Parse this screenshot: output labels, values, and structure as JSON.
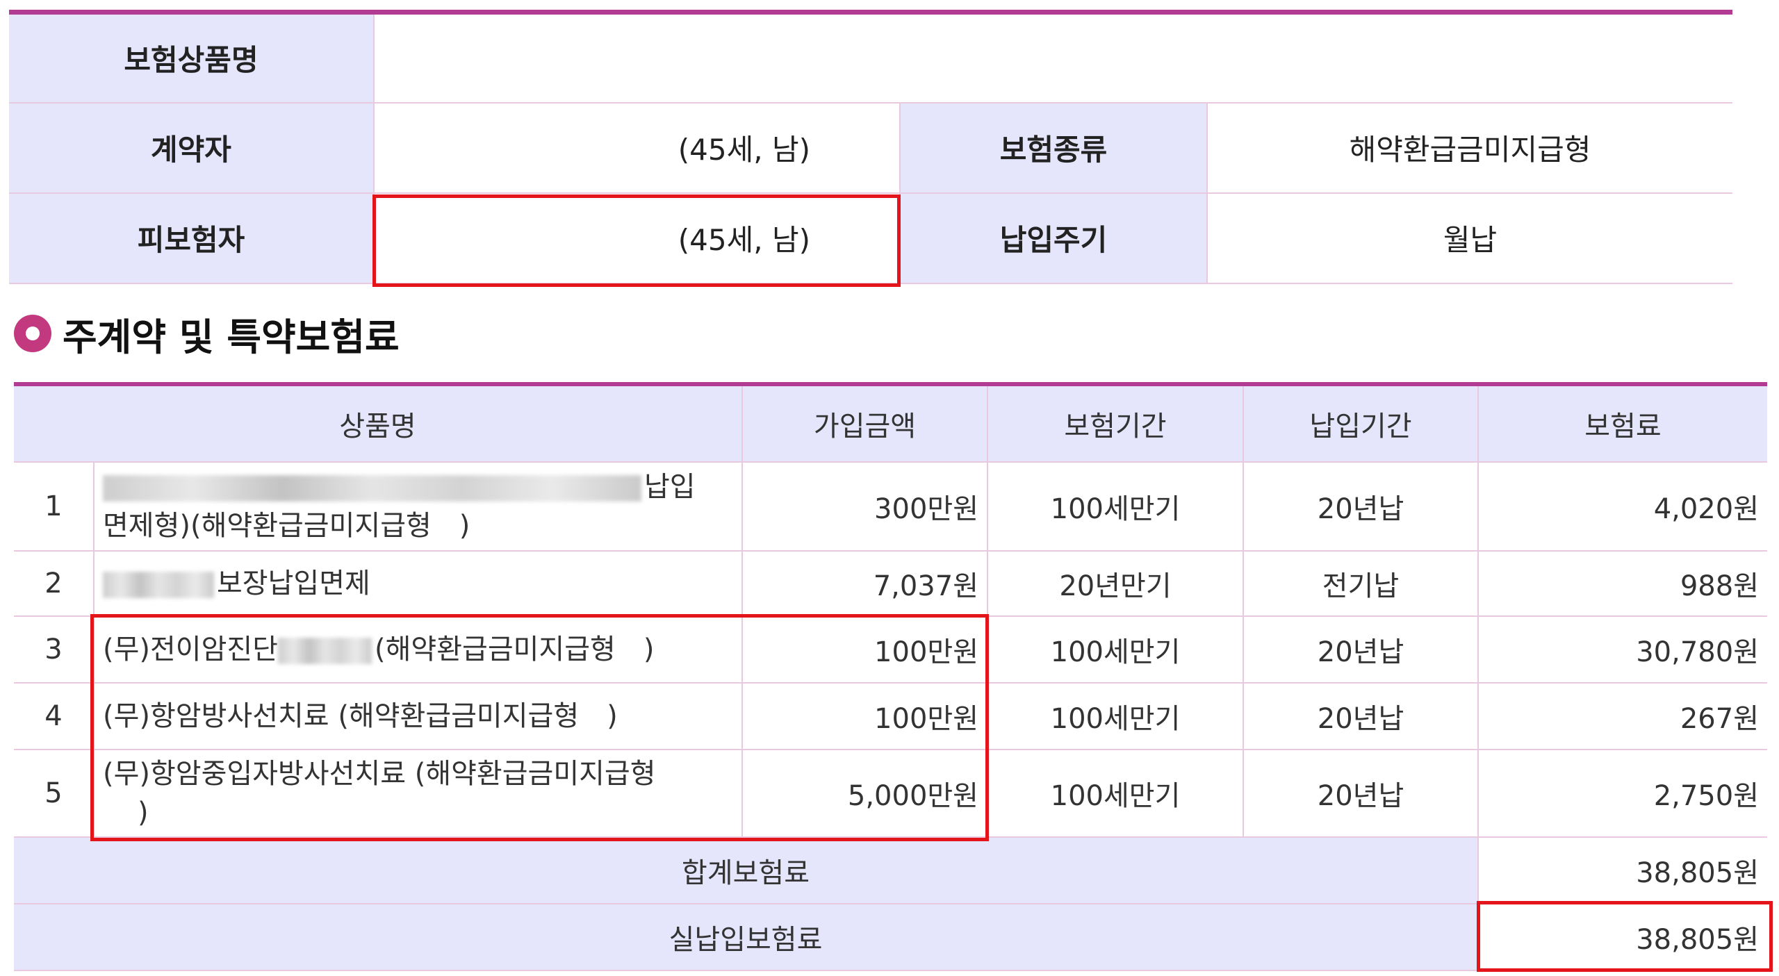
{
  "info": {
    "product_label": "보험상품명",
    "product_value": "",
    "contractor_label": "계약자",
    "contractor_value": "(45세, 남)",
    "type_label": "보험종류",
    "type_value": "해약환급금미지급형",
    "insured_label": "피보험자",
    "insured_value": "(45세, 남)",
    "cycle_label": "납입주기",
    "cycle_value": "월납"
  },
  "section": {
    "title": "주계약 및 특약보험료"
  },
  "table": {
    "headers": [
      "상품명",
      "가입금액",
      "보험기간",
      "납입기간",
      "보험료"
    ],
    "rows": [
      {
        "no": "1",
        "name_line1": "납입",
        "name_line2": "면제형)(해약환급금미지급형　)",
        "amount": "300만원",
        "period": "100세만기",
        "pay_period": "20년납",
        "premium": "4,020원"
      },
      {
        "no": "2",
        "name": "보장납입면제",
        "amount": "7,037원",
        "period": "20년만기",
        "pay_period": "전기납",
        "premium": "988원"
      },
      {
        "no": "3",
        "name_pre": "(무)전이암진단",
        "name_post": "(해약환급금미지급형　)",
        "amount": "100만원",
        "period": "100세만기",
        "pay_period": "20년납",
        "premium": "30,780원"
      },
      {
        "no": "4",
        "name": "(무)항암방사선치료 (해약환급금미지급형　)",
        "amount": "100만원",
        "period": "100세만기",
        "pay_period": "20년납",
        "premium": "267원"
      },
      {
        "no": "5",
        "name_line1": "(무)항암중입자방사선치료 (해약환급금미지급형",
        "name_line2": ")",
        "amount": "5,000만원",
        "period": "100세만기",
        "pay_period": "20년납",
        "premium": "2,750원"
      }
    ],
    "total_label": "합계보험료",
    "total_value": "38,805원",
    "actual_label": "실납입보험료",
    "actual_value": "38,805원"
  },
  "colors": {
    "accent": "#b23c93",
    "header_bg": "#e5e5fc",
    "border": "#e8c9e0",
    "highlight": "#e3141a",
    "bullet": "#c2397f"
  }
}
